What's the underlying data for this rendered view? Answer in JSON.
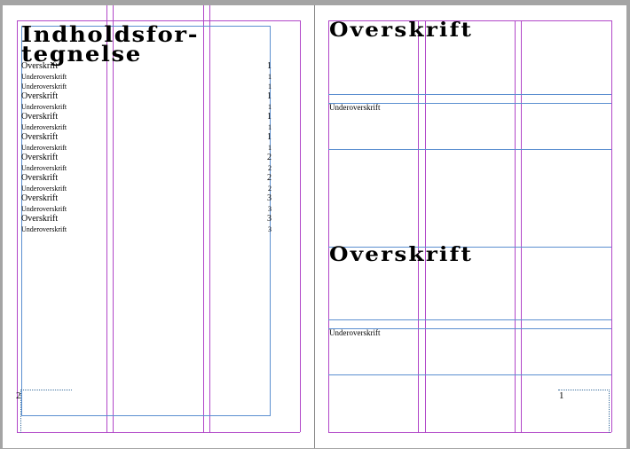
{
  "left_page": {
    "title": "Indholdsfor-tegnelse",
    "toc": [
      {
        "label": "Overskrift",
        "page": "1",
        "level": "h"
      },
      {
        "label": "Underoverskrift",
        "page": "1",
        "level": "s"
      },
      {
        "label": "Underoverskrift",
        "page": "1",
        "level": "s"
      },
      {
        "label": "Overskrift",
        "page": "1",
        "level": "h"
      },
      {
        "label": "Underoverskrift",
        "page": "1",
        "level": "s"
      },
      {
        "label": "Overskrift",
        "page": "1",
        "level": "h"
      },
      {
        "label": "Underoverskrift",
        "page": "1",
        "level": "s"
      },
      {
        "label": "Overskrift",
        "page": "1",
        "level": "h"
      },
      {
        "label": "Underoverskrift",
        "page": "1",
        "level": "s"
      },
      {
        "label": "Overskrift",
        "page": "2",
        "level": "h"
      },
      {
        "label": "Underoverskrift",
        "page": "2",
        "level": "s"
      },
      {
        "label": "Overskrift",
        "page": "2",
        "level": "h"
      },
      {
        "label": "Underoverskrift",
        "page": "2",
        "level": "s"
      },
      {
        "label": "Overskrift",
        "page": "3",
        "level": "h"
      },
      {
        "label": "Underoverskrift",
        "page": "3",
        "level": "s"
      },
      {
        "label": "Overskrift",
        "page": "3",
        "level": "h"
      },
      {
        "label": "Underoverskrift",
        "page": "3",
        "level": "s"
      }
    ],
    "folio": "2"
  },
  "right_page": {
    "sections": [
      {
        "heading": "Overskrift",
        "subheading": "Underoverskrift"
      },
      {
        "heading": "Overskrift",
        "subheading": "Underoverskrift"
      }
    ],
    "folio": "1"
  },
  "colors": {
    "margin_guide": "#b146c8",
    "frame_edge": "#5b8fd0",
    "pasteboard": "#a4a4a4"
  }
}
